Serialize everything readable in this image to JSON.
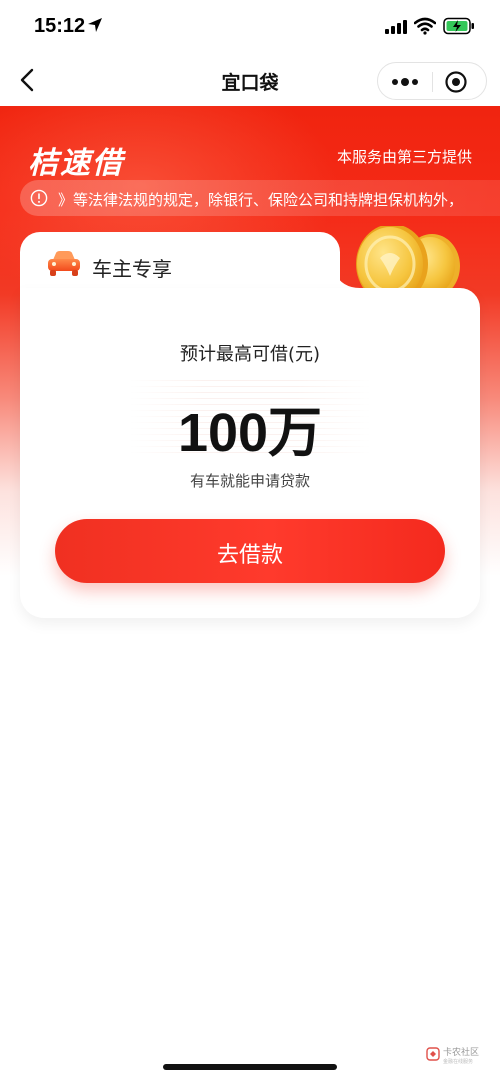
{
  "status_bar": {
    "time": "15:12"
  },
  "nav": {
    "title": "宜口袋"
  },
  "hero": {
    "brand": "桔速借",
    "provider_text": "本服务由第三方提供",
    "notice": "》等法律法规的规定，除银行、保险公司和持牌担保机构外，"
  },
  "card": {
    "tab_title": "车主专享",
    "limit_label": "预计最高可借(元)",
    "amount": "100万",
    "subtitle": "有车就能申请贷款",
    "cta_label": "去借款"
  },
  "watermark": {
    "text": "卡农社区",
    "sub": "金融在线服务"
  },
  "colors": {
    "primary_red": "#f52a17",
    "button_red": "#ff3a2c",
    "coin_gold": "#f5c542"
  }
}
